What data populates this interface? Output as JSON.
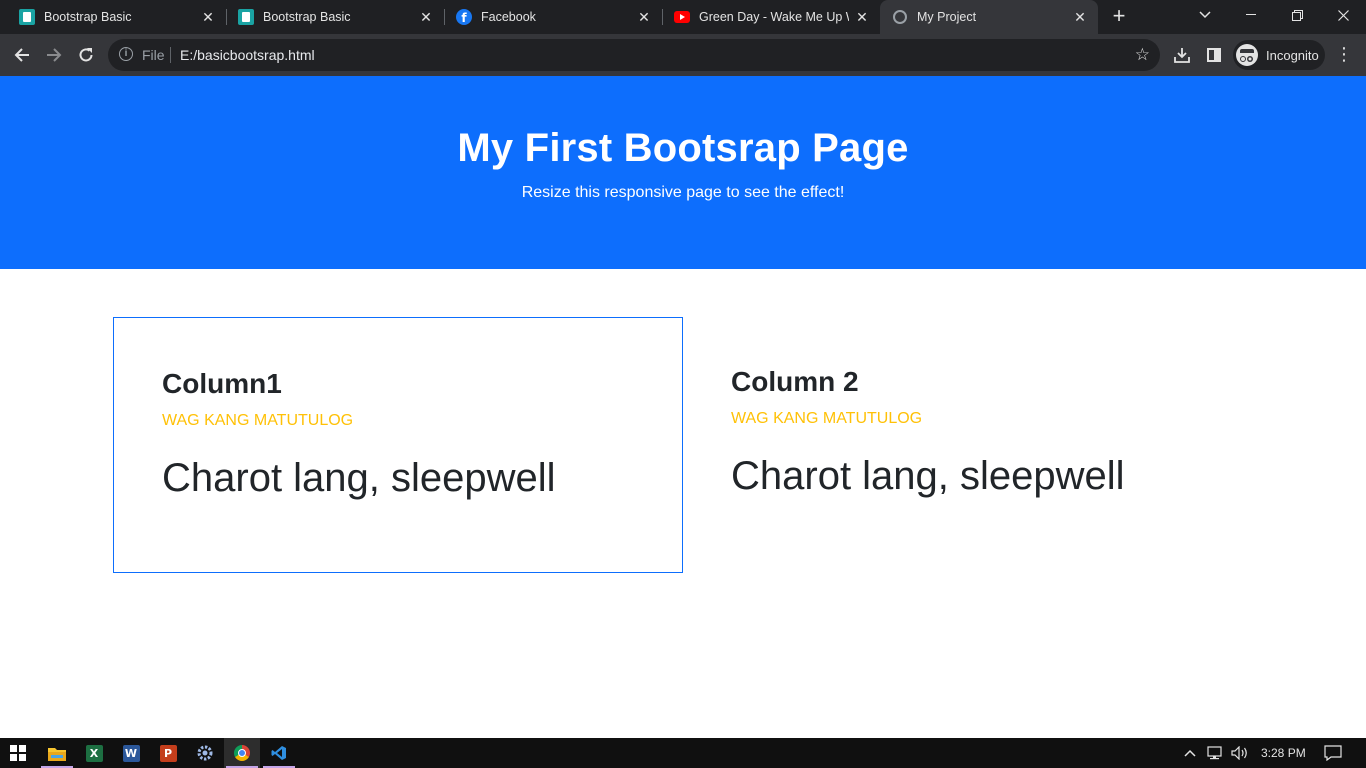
{
  "browser": {
    "tabs": [
      {
        "title": "Bootstrap Basic",
        "icon": "sheet-icon",
        "active": false
      },
      {
        "title": "Bootstrap Basic",
        "icon": "sheet-icon",
        "active": false
      },
      {
        "title": "Facebook",
        "icon": "facebook-icon",
        "active": false
      },
      {
        "title": "Green Day - Wake Me Up Wh",
        "icon": "youtube-icon",
        "active": false
      },
      {
        "title": "My Project",
        "icon": "globe-icon",
        "active": true
      }
    ],
    "new_tab_label": "+",
    "address": {
      "scheme_label": "File",
      "url": "E:/basicbootsrap.html"
    },
    "profile_label": "Incognito"
  },
  "page": {
    "jumbotron": {
      "title": "My First Bootsrap Page",
      "subtitle": "Resize this responsive page to see the effect!",
      "background_color": "#0d6efd"
    },
    "columns": [
      {
        "heading": "Column1",
        "subheading": "WAG KANG MATUTULOG",
        "lead": "Charot lang, sleepwell",
        "bordered": true
      },
      {
        "heading": "Column 2",
        "subheading": "WAG KANG MATUTULOG",
        "lead": "Charot lang, sleepwell",
        "bordered": false
      }
    ],
    "accent_color": "#ffc107"
  },
  "taskbar": {
    "apps": [
      "file-explorer-icon",
      "excel-icon",
      "word-icon",
      "powerpoint-icon",
      "settings-icon",
      "chrome-icon",
      "vscode-icon"
    ],
    "clock": "3:28 PM"
  }
}
